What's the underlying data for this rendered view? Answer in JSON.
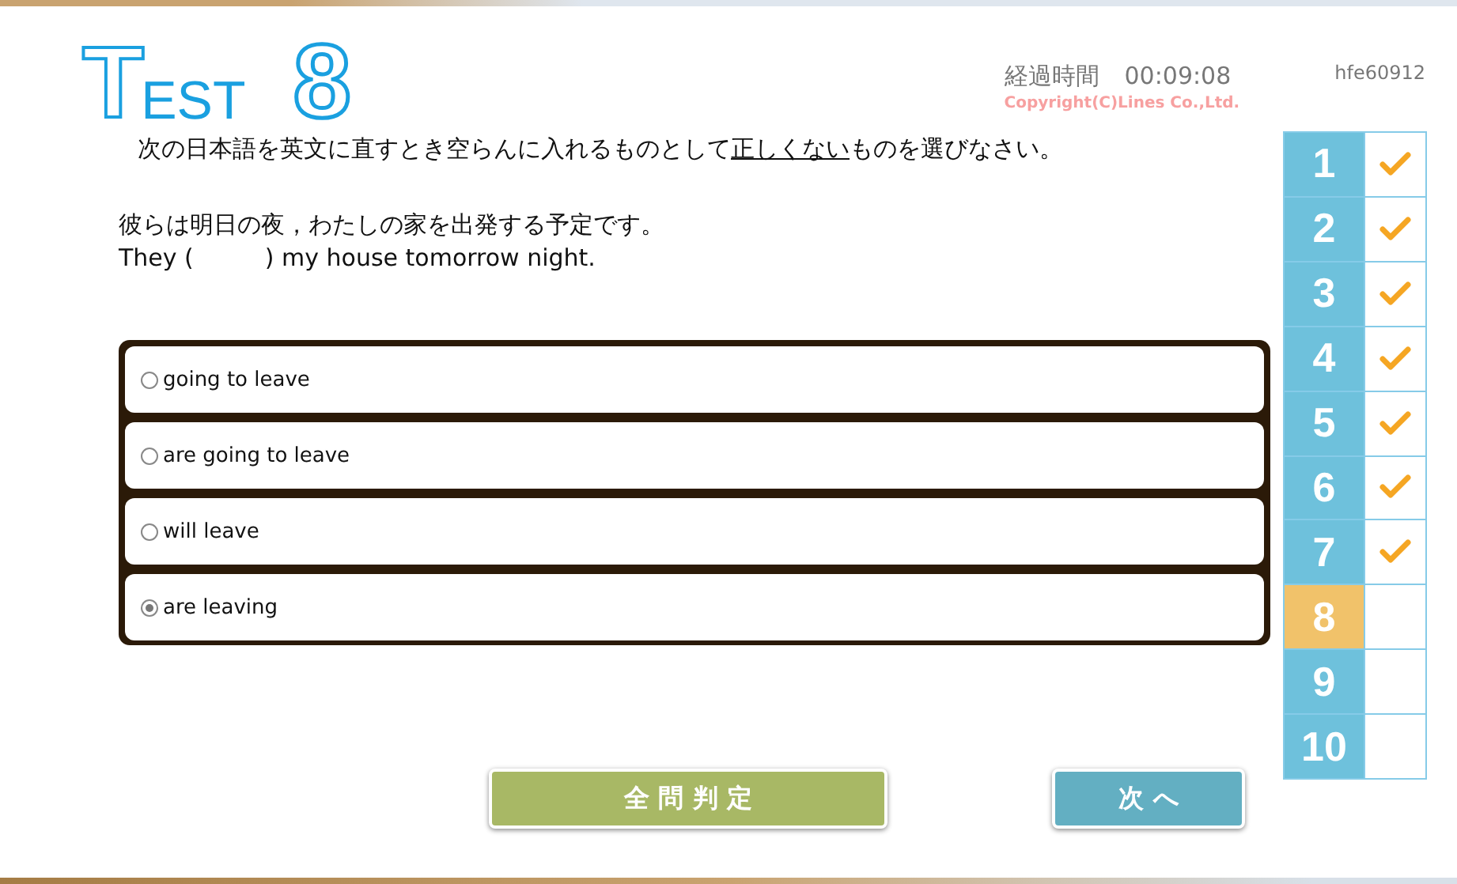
{
  "title": {
    "initial": "T",
    "rest": "EST",
    "number": "8"
  },
  "timer": {
    "label": "経過時間",
    "time": "00:09:08"
  },
  "copyright": "Copyright(C)Lines Co.,Ltd.",
  "user_id": "hfe60912",
  "instruction": [
    {
      "text": "次の日本語を英文に直すとき空らんに入れるものとして",
      "underline": false
    },
    {
      "text": "正しくない",
      "underline": true
    },
    {
      "text": "ものを選びなさい。",
      "underline": false
    }
  ],
  "question": {
    "japanese": "彼らは明日の夜，わたしの家を出発する予定です。",
    "english": "They (　　　) my house tomorrow night."
  },
  "options": [
    {
      "label": "going to leave",
      "selected": false
    },
    {
      "label": "are going to leave",
      "selected": false
    },
    {
      "label": "will leave",
      "selected": false
    },
    {
      "label": "are leaving",
      "selected": true
    }
  ],
  "questions": [
    {
      "number": "1",
      "answered": true,
      "selected": false
    },
    {
      "number": "2",
      "answered": true,
      "selected": false
    },
    {
      "number": "3",
      "answered": true,
      "selected": false
    },
    {
      "number": "4",
      "answered": true,
      "selected": false
    },
    {
      "number": "5",
      "answered": true,
      "selected": false
    },
    {
      "number": "6",
      "answered": true,
      "selected": false
    },
    {
      "number": "7",
      "answered": true,
      "selected": false
    },
    {
      "number": "8",
      "answered": false,
      "selected": true
    },
    {
      "number": "9",
      "answered": false,
      "selected": false
    },
    {
      "number": "10",
      "answered": false,
      "selected": false
    }
  ],
  "buttons": [
    {
      "label": "全 問 判 定",
      "kind": "grade"
    },
    {
      "label": "次 へ",
      "kind": "next"
    }
  ]
}
